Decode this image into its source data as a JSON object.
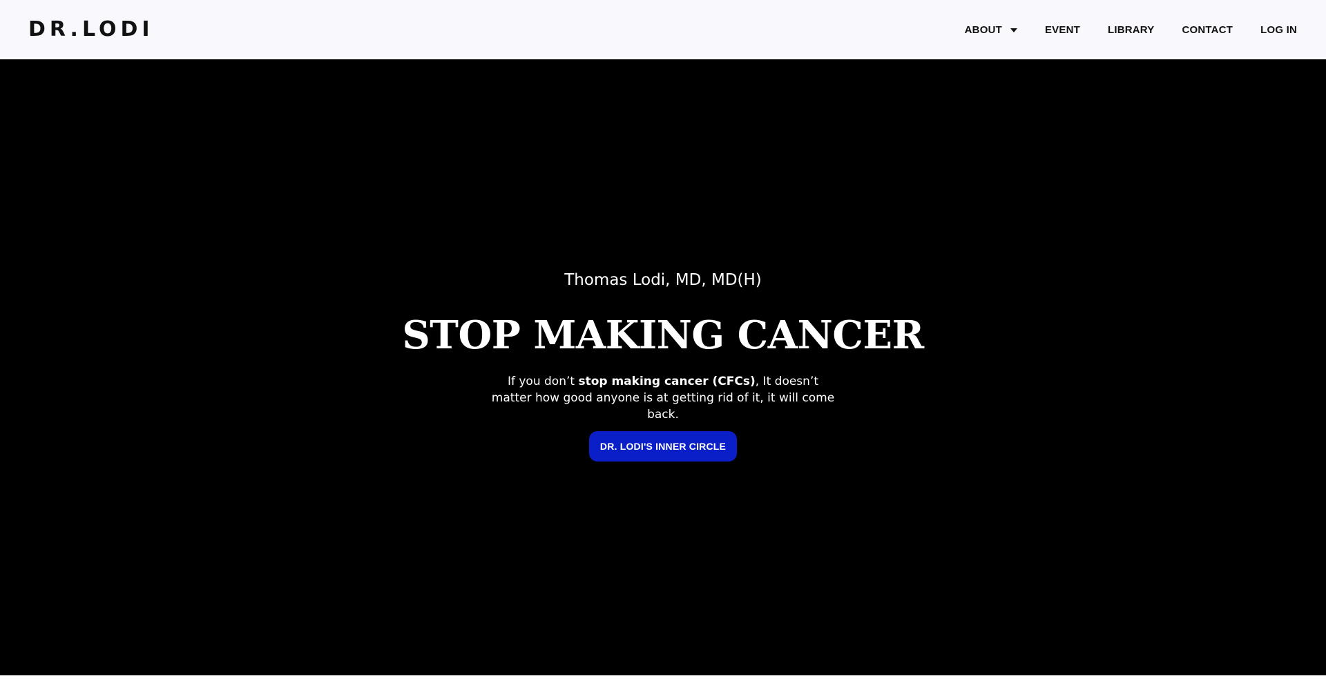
{
  "header": {
    "logo": "DR.LODI",
    "nav": [
      {
        "label": "ABOUT",
        "has_dropdown": true
      },
      {
        "label": "EVENT"
      },
      {
        "label": "LIBRARY"
      },
      {
        "label": "CONTACT"
      },
      {
        "label": "LOG IN"
      }
    ]
  },
  "hero": {
    "subtitle": "Thomas Lodi, MD, MD(H)",
    "headline": "STOP MAKING CANCER",
    "body_prefix": "If you don’t ",
    "body_bold": "stop making cancer (CFCs)",
    "body_suffix": ", It doesn’t matter how good anyone is at getting rid of it, it will come back.",
    "cta_label": "DR. LODI'S INNER CIRCLE"
  },
  "colors": {
    "header_bg": "#f8f8fd",
    "hero_bg": "#000000",
    "cta_bg": "#0a1fc8",
    "text_dark": "#111111",
    "text_light": "#ffffff"
  }
}
